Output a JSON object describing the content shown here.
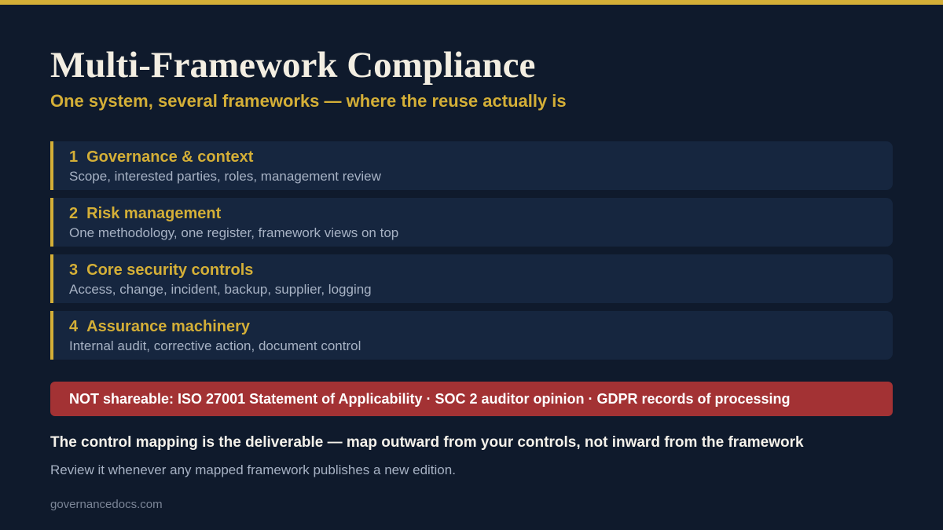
{
  "title": "Multi-Framework Compliance",
  "subtitle": "One system, several frameworks — where the reuse actually is",
  "items": [
    {
      "number": "1",
      "title": "Governance & context",
      "description": "Scope, interested parties, roles, management review"
    },
    {
      "number": "2",
      "title": "Risk management",
      "description": "One methodology, one register, framework views on top"
    },
    {
      "number": "3",
      "title": "Core security controls",
      "description": "Access, change, incident, backup, supplier, logging"
    },
    {
      "number": "4",
      "title": "Assurance machinery",
      "description": "Internal audit, corrective action, document control"
    }
  ],
  "warning": "NOT shareable: ISO 27001 Statement of Applicability · SOC 2 auditor opinion · GDPR records of processing",
  "key_point": "The control mapping is the deliverable — map outward from your controls, not inward from the framework",
  "note": "Review it whenever any mapped framework publishes a new edition.",
  "footer": "governancedocs.com",
  "colors": {
    "background": "#0f1a2c",
    "accent": "#d4af37",
    "card": "#16263f",
    "warning": "#a33234"
  }
}
